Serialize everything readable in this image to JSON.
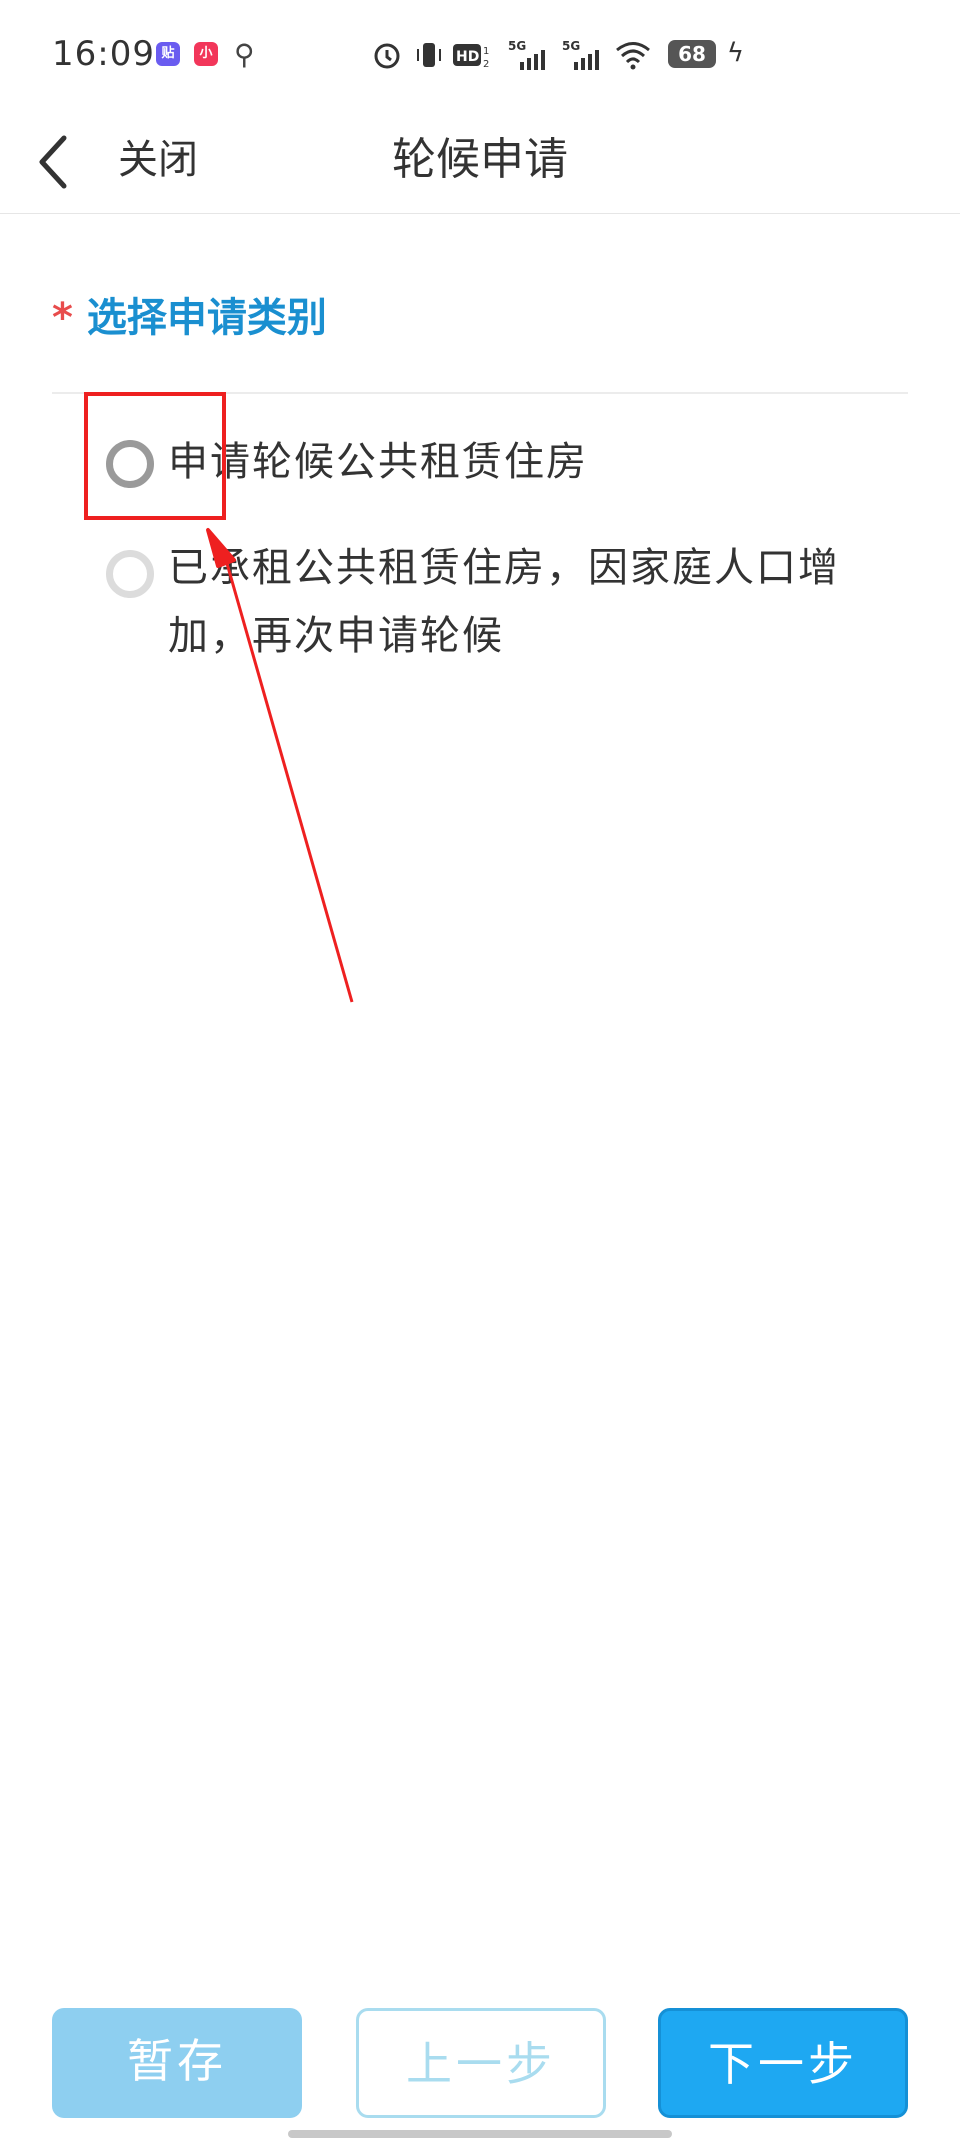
{
  "status_bar": {
    "time": "16:09",
    "app_icon_1": "贴",
    "app_icon_2": "小",
    "battery": "68",
    "icons": [
      "usb-icon",
      "alarm-icon",
      "vibrate-icon",
      "hd-icon",
      "signal-5g-icon",
      "signal-5g-icon",
      "wifi-icon",
      "battery-icon",
      "charging-icon"
    ]
  },
  "header": {
    "back_icon": "chevron-left-icon",
    "close_label": "关闭",
    "title": "轮候申请"
  },
  "section": {
    "required_mark": "*",
    "label": "选择申请类别"
  },
  "options": [
    {
      "label": "申请轮候公共租赁住房",
      "selected": false
    },
    {
      "label": "已承租公共租赁住房，因家庭人口增加，再次申请轮候",
      "selected": false
    }
  ],
  "buttons": {
    "save": "暂存",
    "prev": "上一步",
    "next": "下一步"
  },
  "colors": {
    "accent": "#1ea8f2",
    "section_label": "#1a8fd0",
    "required": "#e84c4c",
    "annotation": "#ee2020"
  }
}
